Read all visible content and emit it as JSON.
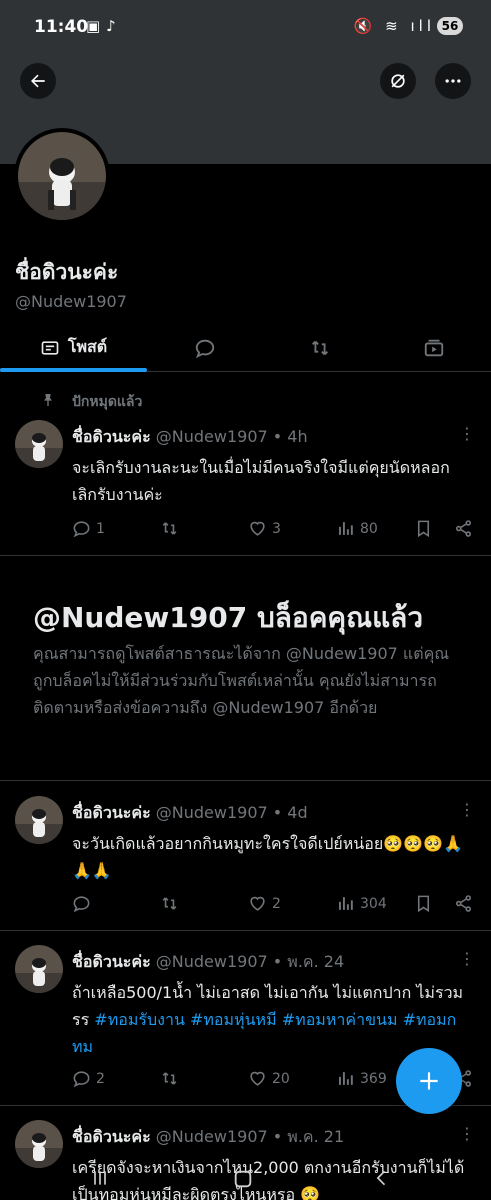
{
  "status_bar": {
    "time": "11:40",
    "battery": "56"
  },
  "profile": {
    "name": "ชื่อดิวนะค่ะ",
    "handle": "@Nudew1907"
  },
  "tabs": [
    {
      "label": "โพสต์",
      "active": true
    }
  ],
  "pinned_label": "ปักหมุดแล้ว",
  "posts": [
    {
      "name": "ชื่อดิวนะค่ะ",
      "meta": "@Nudew1907 • 4h",
      "text": "จะเลิกรับงานละนะในเมื่อไม่มีคนจริงใจมีแต่คุยนัดหลอกเลิกรับงานค่ะ",
      "replies": "1",
      "reposts": "",
      "likes": "3",
      "views": "80"
    },
    {
      "name": "ชื่อดิวนะค่ะ",
      "meta": "@Nudew1907 • 4d",
      "text": "จะวันเกิดแล้วอยากกินหมูทะใครใจดีเปย์หน่อย🥺🥺🥺🙏🙏🙏",
      "replies": "",
      "reposts": "",
      "likes": "2",
      "views": "304"
    },
    {
      "name": "ชื่อดิวนะค่ะ",
      "meta": "@Nudew1907 • พ.ค. 24",
      "text_plain": "ถ้าเหลือ500/1น้ำ ไม่เอาสด ไม่เอากัน ไม่แตกปาก ไม่รวมรร ",
      "hashtags": "#ทอมรับงาน #ทอมหุ่นหมี #ทอมหาค่าขนม #ทอมกทม",
      "replies": "2",
      "reposts": "",
      "likes": "20",
      "views": "369"
    },
    {
      "name": "ชื่อดิวนะค่ะ",
      "meta": "@Nudew1907 • พ.ค. 21",
      "text": "เครียดจังจะหาเงินจากไหน2,000 ตกงานอีกรับงานก็ไม่ได้ เป็นทอมหุ่นหมีละผิดตรงไหนหรอ 🥺"
    }
  ],
  "blocked": {
    "title": "@Nudew1907 บล็อคคุณแล้ว",
    "text": "คุณสามารถดูโพสต์สาธารณะได้จาก @Nudew1907 แต่คุณถูกบล็อคไม่ให้มีส่วนร่วมกับโพสต์เหล่านั้น คุณยังไม่สามารถติดตามหรือส่งข้อความถึง @Nudew1907 อีกด้วย"
  },
  "colors": {
    "accent": "#1d9bf0",
    "background": "#000000",
    "muted": "#71767b",
    "banner": "#2f3336"
  },
  "icons": [
    "back-arrow-icon",
    "unmute-icon",
    "more-icon",
    "pin-icon",
    "reply-icon",
    "repost-icon",
    "like-icon",
    "views-icon",
    "bookmark-icon",
    "share-icon",
    "plus-icon"
  ]
}
